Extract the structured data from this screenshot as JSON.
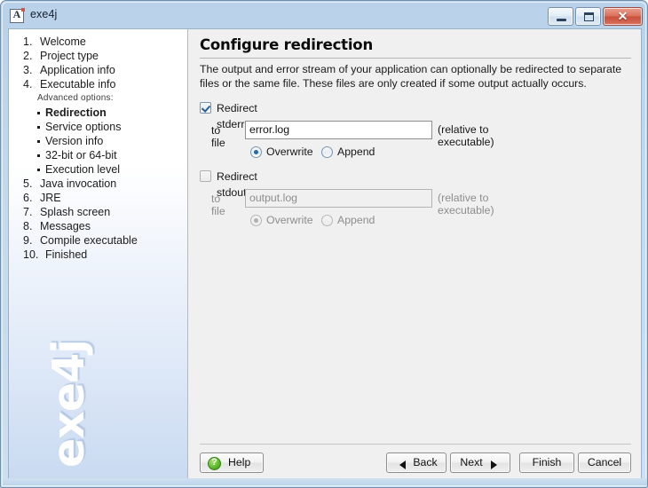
{
  "window": {
    "title": "exe4j",
    "icon": "app-icon",
    "controls": {
      "minimize": "—",
      "maximize": "□",
      "close": "✕"
    }
  },
  "sidebar": {
    "items": [
      {
        "num": "1.",
        "label": "Welcome"
      },
      {
        "num": "2.",
        "label": "Project type"
      },
      {
        "num": "3.",
        "label": "Application info"
      },
      {
        "num": "4.",
        "label": "Executable info"
      }
    ],
    "advanced_header": "Advanced options:",
    "sub_items": [
      {
        "label": "Redirection",
        "current": true
      },
      {
        "label": "Service options",
        "current": false
      },
      {
        "label": "Version info",
        "current": false
      },
      {
        "label": "32-bit or 64-bit",
        "current": false
      },
      {
        "label": "Execution level",
        "current": false
      }
    ],
    "items_after": [
      {
        "num": "5.",
        "label": "Java invocation"
      },
      {
        "num": "6.",
        "label": "JRE"
      },
      {
        "num": "7.",
        "label": "Splash screen"
      },
      {
        "num": "8.",
        "label": "Messages"
      },
      {
        "num": "9.",
        "label": "Compile executable"
      },
      {
        "num": "10.",
        "label": "Finished"
      }
    ],
    "watermark": "exe4j"
  },
  "content": {
    "title": "Configure redirection",
    "description": "The output and error stream of your application can optionally be redirected to separate files or the same file. These files are only created if some output actually occurs.",
    "stderr": {
      "checkbox_label": "Redirect stderr",
      "checked": true,
      "file_label": "to file",
      "file_value": "error.log",
      "hint": "(relative to executable)",
      "mode_overwrite": "Overwrite",
      "mode_append": "Append",
      "selected_mode": "Overwrite"
    },
    "stdout": {
      "checkbox_label": "Redirect stdout",
      "checked": false,
      "file_label": "to file",
      "file_value": "output.log",
      "hint": "(relative to executable)",
      "mode_overwrite": "Overwrite",
      "mode_append": "Append",
      "selected_mode": "Overwrite"
    }
  },
  "buttons": {
    "help": "Help",
    "back": "Back",
    "next": "Next",
    "finish": "Finish",
    "cancel": "Cancel"
  },
  "colors": {
    "title_bar": "#c5daee",
    "close_button": "#c8503c",
    "help_icon": "#61bb2e",
    "radio_dot": "#2a66a8",
    "check_mark": "#2a5d96"
  }
}
